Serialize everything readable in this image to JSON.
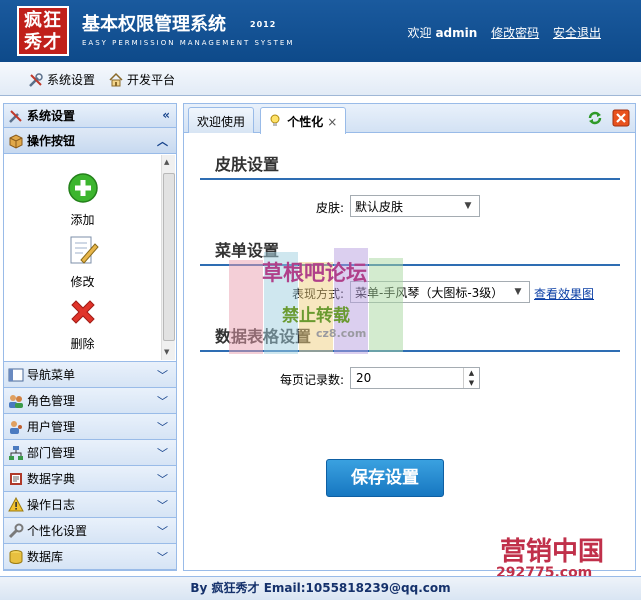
{
  "header": {
    "logo_text": "疯狂\n秀才",
    "title": "基本权限管理系统",
    "year": "2012",
    "subtitle": "EASY PERMISSION MANAGEMENT SYSTEM",
    "welcome": "欢迎",
    "user": "admin",
    "change_password": "修改密码",
    "logout": "安全退出"
  },
  "toolbar": {
    "system_settings": "系统设置",
    "dev_platform": "开发平台"
  },
  "sidebar": {
    "title": "系统设置",
    "open_section": "操作按钮",
    "buttons": [
      {
        "label": "添加"
      },
      {
        "label": "修改"
      },
      {
        "label": "删除"
      }
    ],
    "sections": [
      {
        "label": "导航菜单"
      },
      {
        "label": "角色管理"
      },
      {
        "label": "用户管理"
      },
      {
        "label": "部门管理"
      },
      {
        "label": "数据字典"
      },
      {
        "label": "操作日志"
      },
      {
        "label": "个性化设置"
      },
      {
        "label": "数据库"
      }
    ]
  },
  "tabs": [
    {
      "label": "欢迎使用"
    },
    {
      "label": "个性化",
      "close": "×"
    }
  ],
  "form": {
    "skin_section": "皮肤设置",
    "skin_label": "皮肤:",
    "skin_value": "默认皮肤",
    "menu_section": "菜单设置",
    "menu_label": "表现方式:",
    "menu_value": "菜单-手风琴（大图标-3级）",
    "preview_link": "查看效果图",
    "grid_section": "数据表格设置",
    "page_size_label": "每页记录数:",
    "page_size_value": "20",
    "save_button": "保存设置"
  },
  "watermark": {
    "line1": "草根吧论坛",
    "line2": "禁止转载",
    "line3": "cz8.com",
    "corner_title": "营销中国",
    "corner_site": "292775.com"
  },
  "footer": {
    "text": "By 疯狂秀才 Email:1055818239@qq.com"
  },
  "colors": {
    "header_bg": "#1a5a9e",
    "panel_border": "#99bbe8",
    "accent": "#2e6db3",
    "save_button": "#2389cf"
  }
}
